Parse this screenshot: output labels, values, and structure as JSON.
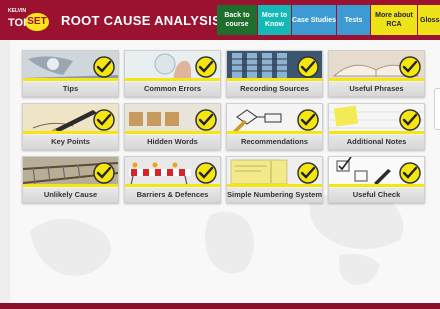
{
  "brand": {
    "small": "KELVIN",
    "top": "TOP",
    "set": "SET"
  },
  "title": "ROOT CAUSE ANALYSIS",
  "nav": {
    "back": "Back to course",
    "more": "More to Know",
    "case": "Case Studies",
    "tests": "Tests",
    "rca": "More about RCA",
    "glossary": "Glossa"
  },
  "tiles": [
    {
      "label": "Tips",
      "icon": "lightbulb-icon"
    },
    {
      "label": "Common Errors",
      "icon": "touch-button-icon"
    },
    {
      "label": "Recording Sources",
      "icon": "server-rack-icon"
    },
    {
      "label": "Useful Phrases",
      "icon": "open-book-icon"
    },
    {
      "label": "Key Points",
      "icon": "fountain-pen-icon"
    },
    {
      "label": "Hidden Words",
      "icon": "wood-blocks-icon"
    },
    {
      "label": "Recommendations",
      "icon": "flowchart-pen-icon"
    },
    {
      "label": "Additional Notes",
      "icon": "sticky-note-icon"
    },
    {
      "label": "Unlikely Cause",
      "icon": "railway-track-icon"
    },
    {
      "label": "Barriers & Defences",
      "icon": "road-barrier-icon"
    },
    {
      "label": "Simple Numbering System",
      "icon": "label-card-icon"
    },
    {
      "label": "Useful Check",
      "icon": "check-form-icon"
    }
  ],
  "colors": {
    "header": "#9b1230",
    "check_yellow": "#f5e60f",
    "tile_bg": "#f2f2f2"
  }
}
